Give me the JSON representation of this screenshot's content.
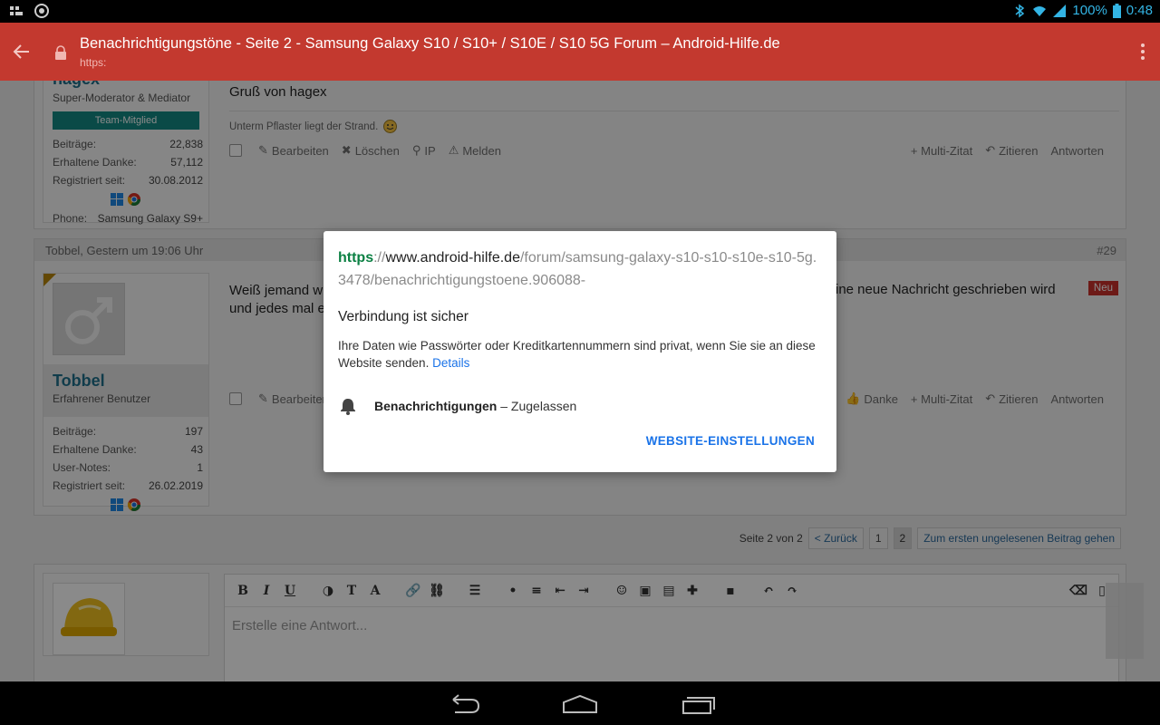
{
  "status_bar": {
    "battery": "100%",
    "time": "0:48",
    "icons": [
      "notification-icon",
      "chrome-icon",
      "bluetooth-icon",
      "wifi-icon",
      "signal-icon",
      "battery-icon"
    ]
  },
  "toolbar": {
    "title": "Benachrichtigungstöne - Seite 2 - Samsung Galaxy S10 / S10+ / S10E / S10 5G Forum – Android-Hilfe.de",
    "url": "https:",
    "color": "#c3392f"
  },
  "post1": {
    "username": "hagex",
    "role": "Super-Moderator & Mediator",
    "badge": "Team-Mitglied",
    "stats": [
      {
        "k": "Beiträge:",
        "v": "22,838"
      },
      {
        "k": "Erhaltene Danke:",
        "v": "57,112"
      },
      {
        "k": "Registriert seit:",
        "v": "30.08.2012"
      }
    ],
    "phone_label": "Phone:",
    "phone_value": "Samsung Galaxy S9+",
    "text": "Gruß von hagex",
    "signature": "Unterm Pflaster liegt der Strand.",
    "actions": [
      "Bearbeiten",
      "Löschen",
      "IP",
      "Melden"
    ],
    "right_actions": [
      "+ Multi-Zitat",
      "Zitieren",
      "Antworten"
    ]
  },
  "post2": {
    "header": "Tobbel, Gestern um 19:06 Uhr",
    "number": "#29",
    "username": "Tobbel",
    "role": "Erfahrener Benutzer",
    "stats": [
      {
        "k": "Beiträge:",
        "v": "197"
      },
      {
        "k": "Erhaltene Danke:",
        "v": "43"
      },
      {
        "k": "User-Notes:",
        "v": "1"
      },
      {
        "k": "Registriert seit:",
        "v": "26.02.2019"
      }
    ],
    "text_left_1": "Weiß jemand wi",
    "text_left_2": "und jedes mal e",
    "text_right_1": "ine neue Nachricht geschrieben wird",
    "new_badge": "Neu",
    "actions": [
      "Bearbeiten"
    ],
    "right_actions": [
      "Danke",
      "+ Multi-Zitat",
      "Zitieren",
      "Antworten"
    ]
  },
  "pager": {
    "label": "Seite 2 von 2",
    "prev": "< Zurück",
    "pages": [
      "1",
      "2"
    ],
    "current": "2",
    "first_unread": "Zum ersten ungelesenen Beitrag gehen"
  },
  "editor": {
    "placeholder": "Erstelle eine Antwort..."
  },
  "dialog": {
    "url_scheme": "https",
    "url_sep": "://",
    "url_host": "www.android-hilfe.de",
    "url_path": "/forum/samsung-galaxy-s10-s10-s10e-s10-5g.3478/benachrichtigungstoene.906088-",
    "heading": "Verbindung ist sicher",
    "body": "Ihre Daten wie Passwörter oder Kreditkartennummern sind privat, wenn Sie sie an diese Website senden.",
    "details_link": "Details",
    "permission_name": "Benachrichtigungen",
    "permission_state": "– Zugelassen",
    "action": "WEBSITE-EINSTELLUNGEN"
  }
}
